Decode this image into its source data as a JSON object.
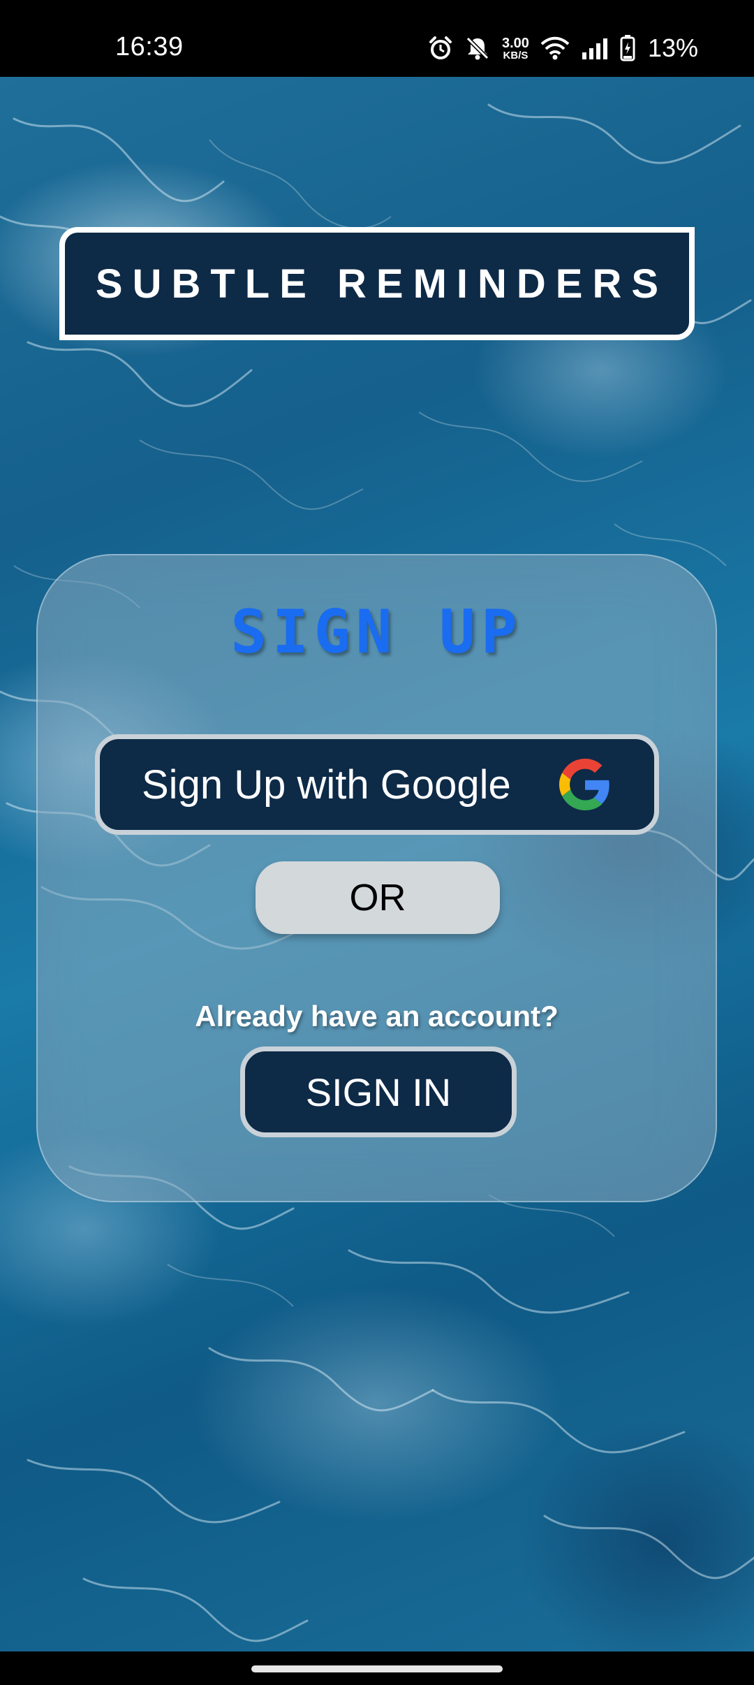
{
  "status_bar": {
    "time": "16:39",
    "net_speed_value": "3.00",
    "net_speed_unit": "KB/S",
    "battery": "13%"
  },
  "app": {
    "title": "SUBTLE REMINDERS"
  },
  "card": {
    "heading": "SIGN UP",
    "google_button_label": "Sign Up with Google",
    "or_label": "OR",
    "already_text": "Already have an account?",
    "sign_in_label": "SIGN IN"
  },
  "icons": {
    "status": [
      "alarm-icon",
      "mute-icon",
      "wifi-icon",
      "signal-icon",
      "battery-charging-icon"
    ],
    "google": "google-g-icon"
  },
  "colors": {
    "banner_bg": "#0d2a47",
    "heading": "#1a6cf0",
    "button_bg": "#0d2a47",
    "button_border": "#c9d2d8",
    "or_pill": "#d3d8db"
  }
}
